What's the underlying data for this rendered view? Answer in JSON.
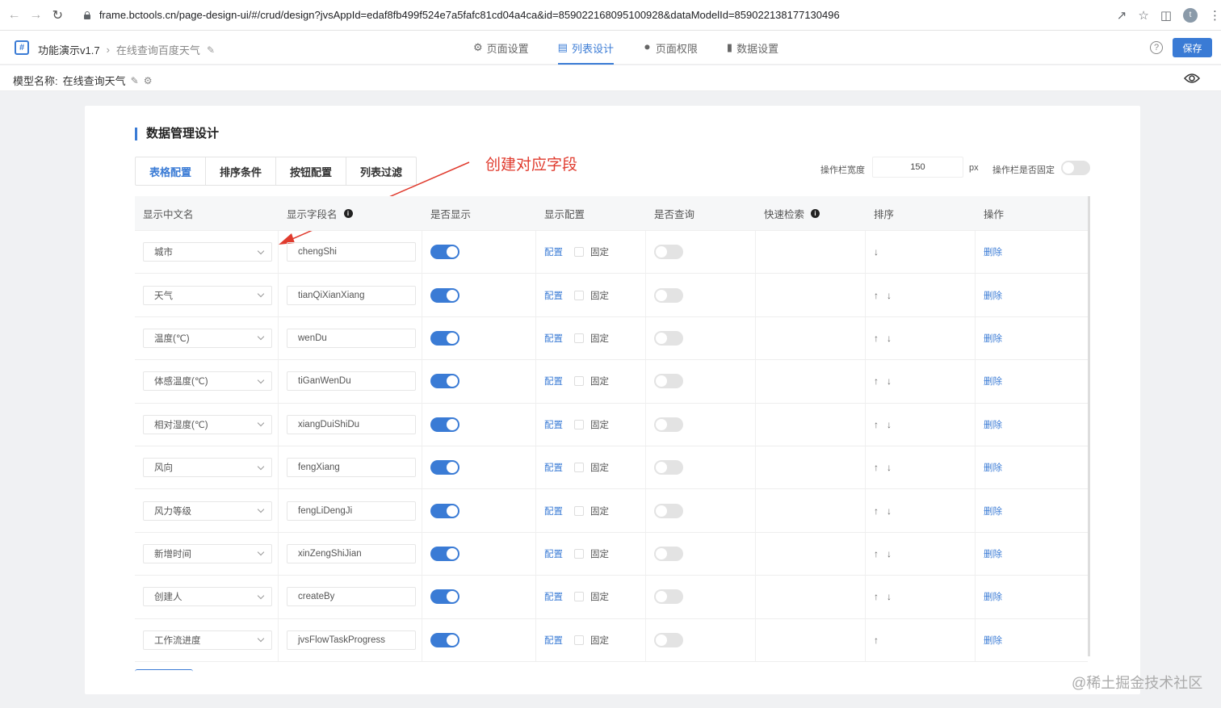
{
  "browser": {
    "url": "frame.bctools.cn/page-design-ui/#/crud/design?jvsAppId=edaf8fb499f524e7a5fafc81cd04a4ca&id=859022168095100928&dataModelId=859022138177130496",
    "avatar_letter": "t"
  },
  "header": {
    "app_name": "功能演示v1.7",
    "page_name": "在线查询百度天气",
    "tabs": [
      {
        "label": "页面设置",
        "icon": "gear-icon"
      },
      {
        "label": "列表设计",
        "icon": "list-icon"
      },
      {
        "label": "页面权限",
        "icon": "lock-icon"
      },
      {
        "label": "数据设置",
        "icon": "bar-chart-icon"
      }
    ],
    "active_tab": "列表设计",
    "save_label": "保存"
  },
  "model": {
    "label": "模型名称:",
    "name": "在线查询天气"
  },
  "card": {
    "title": "数据管理设计",
    "sub_tabs": [
      "表格配置",
      "排序条件",
      "按钮配置",
      "列表过滤"
    ],
    "active_sub_tab": "表格配置",
    "annotation": "创建对应字段",
    "op_width_label": "操作栏宽度",
    "op_width_value": "150",
    "op_width_unit": "px",
    "op_fixed_label": "操作栏是否固定",
    "op_fixed_on": false
  },
  "table": {
    "columns": [
      "显示中文名",
      "显示字段名",
      "是否显示",
      "显示配置",
      "是否查询",
      "快速检索",
      "排序",
      "操作"
    ],
    "config_link": "配置",
    "fixed_label": "固定",
    "delete_link": "删除",
    "rows": [
      {
        "name": "城市",
        "field": "chengShi",
        "show": true,
        "query": false,
        "up": false,
        "down": true
      },
      {
        "name": "天气",
        "field": "tianQiXianXiang",
        "show": true,
        "query": false,
        "up": true,
        "down": true
      },
      {
        "name": "温度(℃)",
        "field": "wenDu",
        "show": true,
        "query": false,
        "up": true,
        "down": true
      },
      {
        "name": "体感温度(℃)",
        "field": "tiGanWenDu",
        "show": true,
        "query": false,
        "up": true,
        "down": true
      },
      {
        "name": "相对湿度(℃)",
        "field": "xiangDuiShiDu",
        "show": true,
        "query": false,
        "up": true,
        "down": true
      },
      {
        "name": "风向",
        "field": "fengXiang",
        "show": true,
        "query": false,
        "up": true,
        "down": true
      },
      {
        "name": "风力等级",
        "field": "fengLiDengJi",
        "show": true,
        "query": false,
        "up": true,
        "down": true
      },
      {
        "name": "新增时间",
        "field": "xinZengShiJian",
        "show": true,
        "query": false,
        "up": true,
        "down": true
      },
      {
        "name": "创建人",
        "field": "createBy",
        "show": true,
        "query": false,
        "up": true,
        "down": true
      },
      {
        "name": "工作流进度",
        "field": "jvsFlowTaskProgress",
        "show": true,
        "query": false,
        "up": true,
        "down": false
      }
    ]
  },
  "watermark": "@稀土掘金技术社区",
  "colors": {
    "accent": "#3a7bd5",
    "annotation": "#e03b2e"
  }
}
